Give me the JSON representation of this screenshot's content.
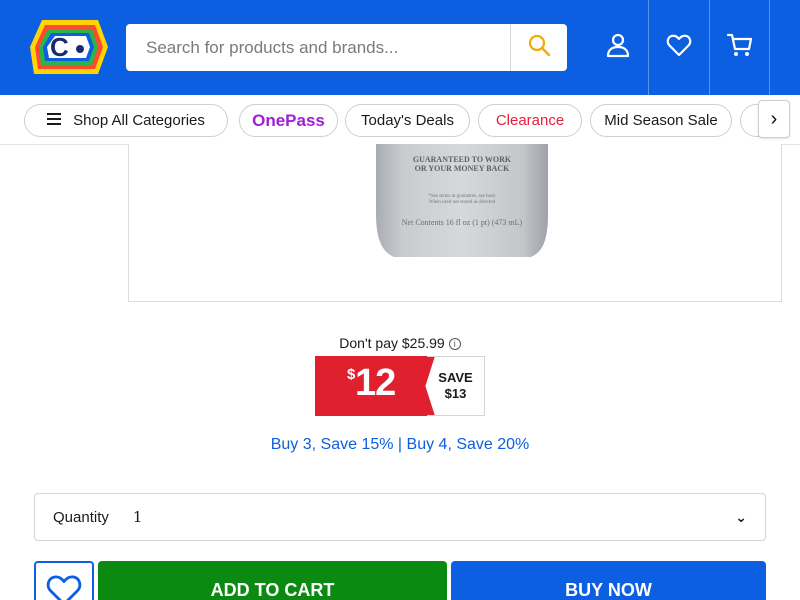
{
  "header": {
    "brand_color": "#0b5fe0",
    "logo_icon": "catch-logo-icon",
    "search": {
      "placeholder": "Search for products and brands...",
      "value": ""
    },
    "icons": [
      "search-icon",
      "account-icon",
      "heart-icon",
      "cart-icon"
    ]
  },
  "nav": {
    "shop_all": "Shop All Categories",
    "onepass": "OnePass",
    "deals": "Today's Deals",
    "clearance": "Clearance",
    "mid_season": "Mid Season Sale",
    "next_arrow": "›"
  },
  "product_image": {
    "label_line1": "GUARANTEED TO WORK",
    "label_line2": "OR YOUR MONEY BACK",
    "small_text1": "*See terms at guarantee, see back",
    "small_text2": "When used not stored as directed",
    "net_contents": "Net Contents 16 fl oz (1 pt) (473 mL)"
  },
  "price": {
    "dont_pay_label": "Don't pay $25.99",
    "info_icon": "i",
    "currency": "$",
    "amount": "12",
    "save_label": "SAVE",
    "save_amount": "$13",
    "price_color": "#e0202e"
  },
  "promo": "Buy 3, Save 15% | Buy 4, Save 20%",
  "quantity": {
    "label": "Quantity",
    "value": "1",
    "chevron": "⌄"
  },
  "actions": {
    "add_to_cart": "ADD TO CART",
    "buy_now": "BUY NOW",
    "add_color": "#0b8a12"
  }
}
